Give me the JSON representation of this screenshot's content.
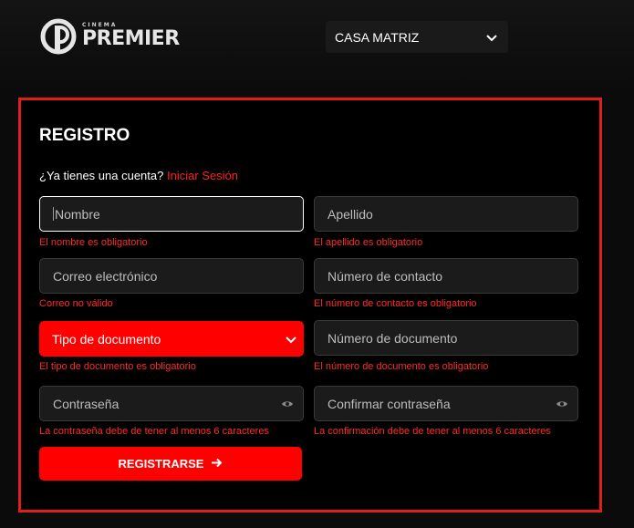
{
  "header": {
    "logo_small": "CINEMA",
    "logo_big": "PREMIER",
    "branch_select": {
      "value": "CASA MATRIZ",
      "icon": "chevron-down-icon"
    }
  },
  "form": {
    "title": "REGISTRO",
    "login_prompt": "¿Ya tienes una cuenta?",
    "login_link": "Iniciar Sesión",
    "fields": {
      "nombre": {
        "placeholder": "Nombre",
        "error": "El nombre es obligatorio"
      },
      "apellido": {
        "placeholder": "Apellido",
        "error": "El apellido es obligatorio"
      },
      "correo": {
        "placeholder": "Correo electrónico",
        "error": "Correo no válido"
      },
      "contacto": {
        "placeholder": "Número de contacto",
        "error": "El número de contacto es obligatorio"
      },
      "tipo_documento": {
        "value": "Tipo de documento",
        "error": "El tipo de documento es obligatorio"
      },
      "numero_documento": {
        "placeholder": "Número de documento",
        "error": "El número de documento es obligatorio"
      },
      "contrasena": {
        "placeholder": "Contraseña",
        "error": "La contraseña debe de tener al menos 6 caracteres"
      },
      "confirmar": {
        "placeholder": "Confirmar contraseña",
        "error": "La confirmación debe de tener al menos 6 caracteres"
      }
    },
    "submit_label": "REGISTRARSE",
    "colors": {
      "accent": "#ff0000",
      "border": "#e01e1e",
      "error": "#ff2a2a"
    }
  }
}
